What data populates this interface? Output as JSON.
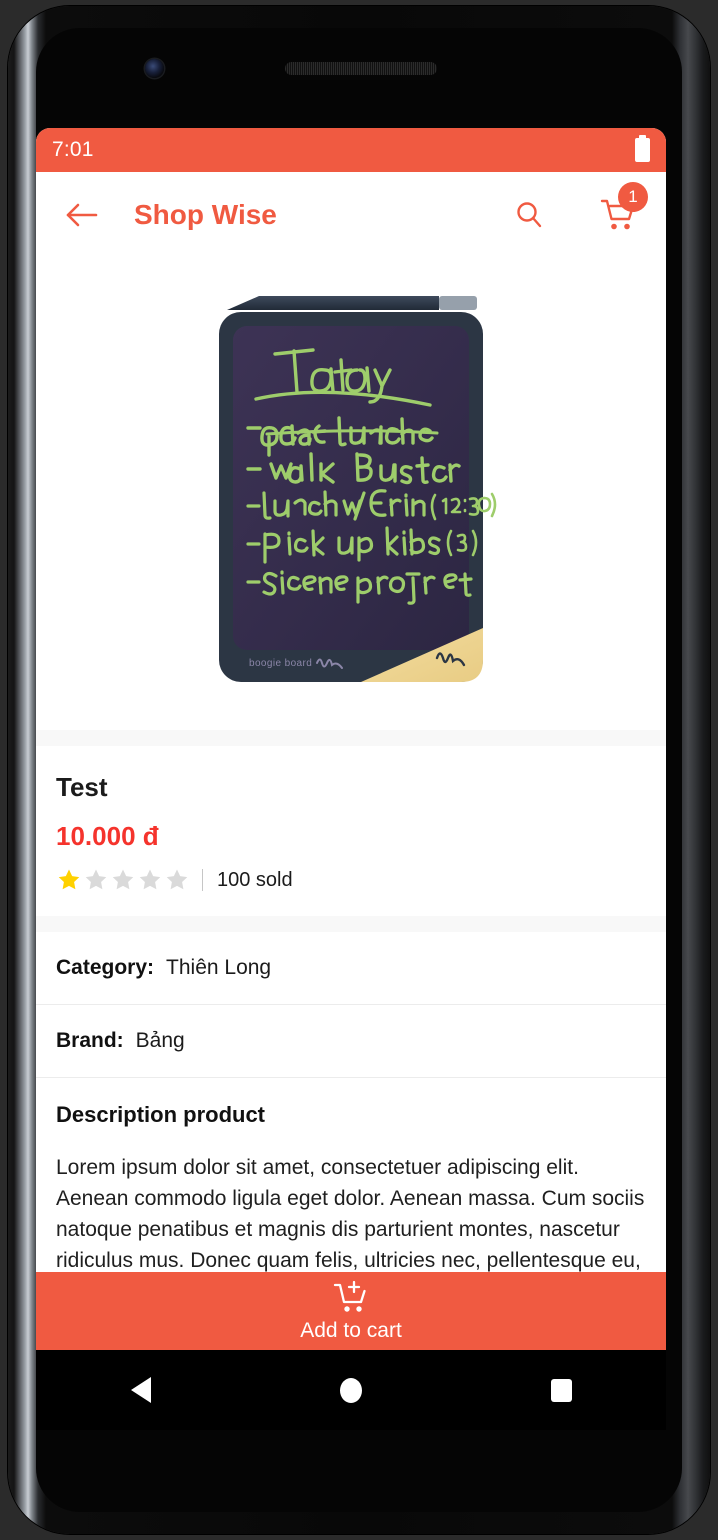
{
  "status_bar": {
    "time": "7:01",
    "battery_icon": "battery-full-icon"
  },
  "app_bar": {
    "back_icon": "arrow-left-icon",
    "title": "Shop Wise",
    "search_icon": "search-icon",
    "cart_icon": "shopping-cart-icon",
    "cart_badge_count": "1"
  },
  "product": {
    "image_alt": "boogie-board-lcd-writing-tablet",
    "image_brand_text": "boogie board",
    "handwritten_lines": [
      "Today",
      "- pack lunches",
      "- Walk Buster",
      "- Lunch w/ Erin (12:30)",
      "- Pick up kids (3)",
      "- Science Project"
    ],
    "name": "Test",
    "price": "10.000 đ",
    "rating_value": 1,
    "rating_max": 5,
    "sold_text": "100 sold",
    "attributes": [
      {
        "label": "Category:",
        "value": "Thiên Long"
      },
      {
        "label": "Brand:",
        "value": "Bảng"
      }
    ],
    "description_title": "Description product",
    "description_body": "Lorem ipsum dolor sit amet, consectetuer adipiscing elit. Aenean commodo ligula eget dolor. Aenean massa. Cum sociis natoque penatibus et magnis dis parturient montes, nascetur ridiculus mus. Donec quam felis, ultricies nec, pellentesque eu, pretium quis, sem. Nulla consequat"
  },
  "cta": {
    "icon": "add-to-cart-icon",
    "label": "Add to cart"
  },
  "nav_bar": {
    "back": "nav-back-icon",
    "home": "nav-home-icon",
    "recents": "nav-recents-icon"
  },
  "colors": {
    "accent": "#F05A41",
    "price": "#F5332C",
    "star_filled": "#FFD100",
    "star_empty": "#DADADA",
    "page_bg": "#F7F7F7"
  }
}
